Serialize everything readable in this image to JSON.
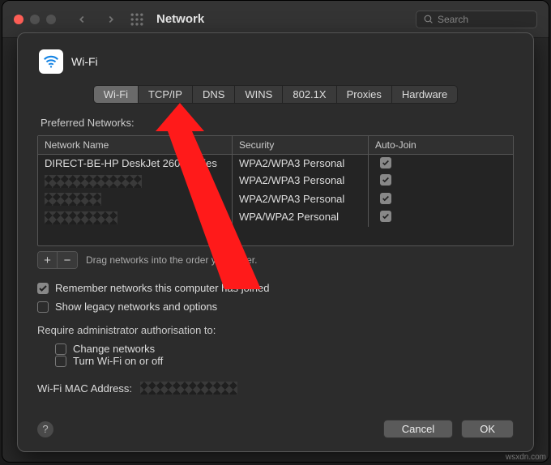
{
  "toolbar": {
    "title": "Network",
    "search_placeholder": "Search"
  },
  "sheet": {
    "header": "Wi-Fi",
    "tabs": [
      "Wi-Fi",
      "TCP/IP",
      "DNS",
      "WINS",
      "802.1X",
      "Proxies",
      "Hardware"
    ],
    "active_tab_index": 0,
    "preferred_label": "Preferred Networks:",
    "columns": {
      "name": "Network Name",
      "security": "Security",
      "autojoin": "Auto-Join"
    },
    "networks": [
      {
        "name": "DIRECT-BE-HP DeskJet 2600 series",
        "redacted": false,
        "security": "WPA2/WPA3 Personal",
        "autojoin": true
      },
      {
        "name": "",
        "redacted": true,
        "security": "WPA2/WPA3 Personal",
        "autojoin": true
      },
      {
        "name": "",
        "redacted": true,
        "security": "WPA2/WPA3 Personal",
        "autojoin": true
      },
      {
        "name": "",
        "redacted": true,
        "security": "WPA/WPA2 Personal",
        "autojoin": true
      }
    ],
    "drag_hint": "Drag networks into the order you prefer.",
    "remember_label": "Remember networks this computer has joined",
    "remember_checked": true,
    "legacy_label": "Show legacy networks and options",
    "legacy_checked": false,
    "require_label": "Require administrator authorisation to:",
    "require_options": [
      {
        "label": "Change networks",
        "checked": false
      },
      {
        "label": "Turn Wi-Fi on or off",
        "checked": false
      }
    ],
    "mac_label": "Wi-Fi MAC Address:",
    "mac_value_redacted": true,
    "cancel_label": "Cancel",
    "ok_label": "OK"
  },
  "watermark": "wsxdn.com"
}
